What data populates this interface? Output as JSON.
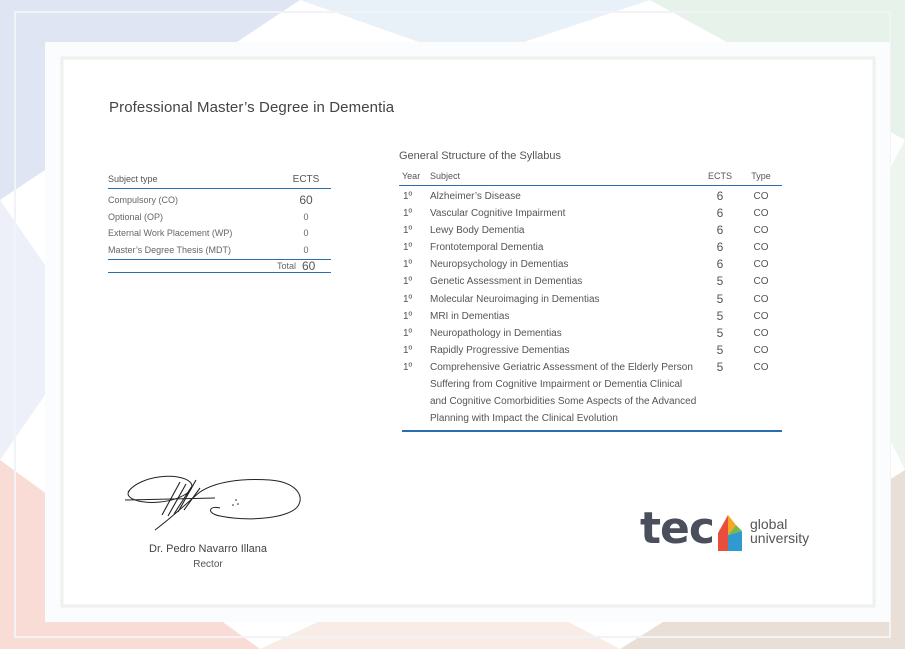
{
  "certificate": {
    "degree_title": "Professional Master’s Degree in Dementia"
  },
  "summary": {
    "header_subject_type": "Subject type",
    "header_ects": "ECTS",
    "rows": [
      {
        "label": "Compulsory (CO)",
        "value": "60"
      },
      {
        "label": "Optional (OP)",
        "value": "0"
      },
      {
        "label": "External Work Placement (WP)",
        "value": "0"
      },
      {
        "label": "Master’s Degree Thesis (MDT)",
        "value": "0"
      }
    ],
    "total_label": "Total",
    "total_value": "60"
  },
  "syllabus": {
    "title": "General Structure of the Syllabus",
    "headers": {
      "year": "Year",
      "subject": "Subject",
      "ects": "ECTS",
      "type": "Type"
    },
    "rows": [
      {
        "year": "1º",
        "subject": "Alzheimer’s Disease",
        "ects": "6",
        "type": "CO"
      },
      {
        "year": "1º",
        "subject": "Vascular Cognitive Impairment",
        "ects": "6",
        "type": "CO"
      },
      {
        "year": "1º",
        "subject": "Lewy Body Dementia",
        "ects": "6",
        "type": "CO"
      },
      {
        "year": "1º",
        "subject": "Frontotemporal Dementia",
        "ects": "6",
        "type": "CO"
      },
      {
        "year": "1º",
        "subject": "Neuropsychology in Dementias",
        "ects": "6",
        "type": "CO"
      },
      {
        "year": "1º",
        "subject": "Genetic Assessment in Dementias",
        "ects": "5",
        "type": "CO"
      },
      {
        "year": "1º",
        "subject": "Molecular Neuroimaging in Dementias",
        "ects": "5",
        "type": "CO"
      },
      {
        "year": "1º",
        "subject": "MRI in Dementias",
        "ects": "5",
        "type": "CO"
      },
      {
        "year": "1º",
        "subject": "Neuropathology in Dementias",
        "ects": "5",
        "type": "CO"
      },
      {
        "year": "1º",
        "subject": "Rapidly Progressive Dementias",
        "ects": "5",
        "type": "CO"
      },
      {
        "year": "1º",
        "subject": "Comprehensive Geriatric Assessment of the Elderly Person Suffering from Cognitive Impairment or Dementia Clinical and Cognitive Comorbidities Some Aspects of the Advanced Planning with Impact the Clinical Evolution",
        "ects": "5",
        "type": "CO"
      }
    ]
  },
  "signatory": {
    "name": "Dr. Pedro Navarro Illana",
    "role": "Rector"
  },
  "logo": {
    "word": "tech",
    "sub_line1": "global",
    "sub_line2": "university",
    "accent_colors": [
      "#e94e3c",
      "#f5a623",
      "#2e9ad0",
      "#7ab648"
    ]
  },
  "colors": {
    "rule": "#2d6cad",
    "text": "#555555"
  }
}
